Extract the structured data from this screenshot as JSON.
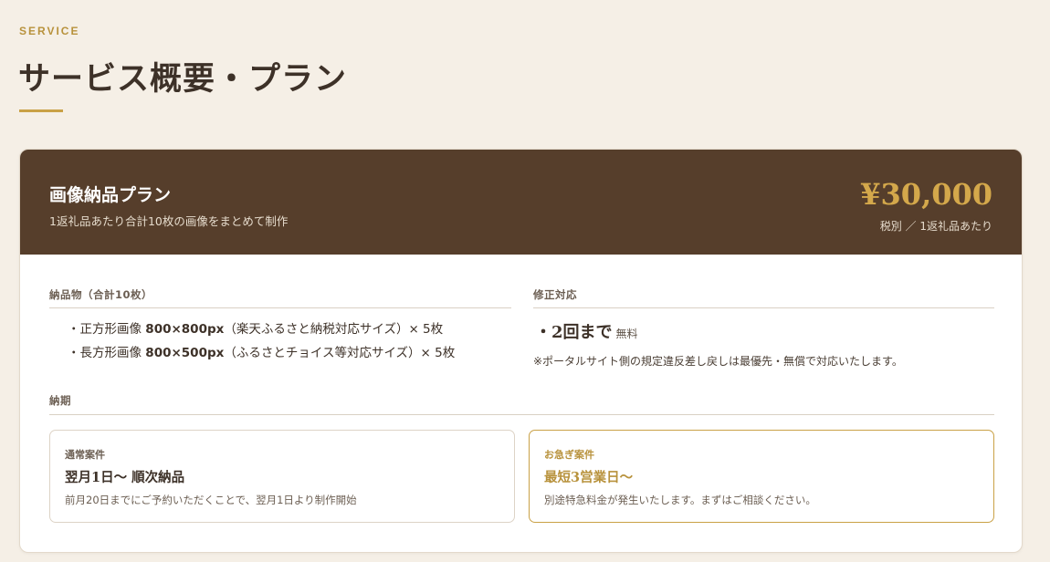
{
  "header": {
    "eyebrow": "SERVICE",
    "title": "サービス概要・プラン"
  },
  "plan": {
    "name": "画像納品プラン",
    "description": "1返礼品あたり合計10枚の画像をまとめて制作",
    "price": "¥30,000",
    "price_note": "税別 ／ 1返礼品あたり"
  },
  "deliverables": {
    "label": "納品物（合計10枚）",
    "items": [
      {
        "bullet": "・",
        "prefix": "正方形画像 ",
        "size": "800×800px",
        "suffix": "（楽天ふるさと納税対応サイズ）× 5枚"
      },
      {
        "bullet": "・",
        "prefix": "長方形画像 ",
        "size": "800×500px",
        "suffix": "（ふるさとチョイス等対応サイズ）× 5枚"
      }
    ]
  },
  "revisions": {
    "label": "修正対応",
    "main": "・2回まで",
    "free": "無料",
    "note": "※ポータルサイト側の規定違反差し戻しは最優先・無償で対応いたします。"
  },
  "lead_time": {
    "label": "納期",
    "normal": {
      "category": "通常案件",
      "title": "翌月1日〜 順次納品",
      "note": "前月20日までにご予約いただくことで、翌月1日より制作開始"
    },
    "rush": {
      "category": "お急ぎ案件",
      "title": "最短3営業日〜",
      "note": "別途特急料金が発生いたします。まずはご相談ください。"
    }
  },
  "colors": {
    "background": "#f5efe6",
    "header_brown": "#563e2b",
    "accent_gold": "#c9a146",
    "text_dark": "#3d3128"
  }
}
